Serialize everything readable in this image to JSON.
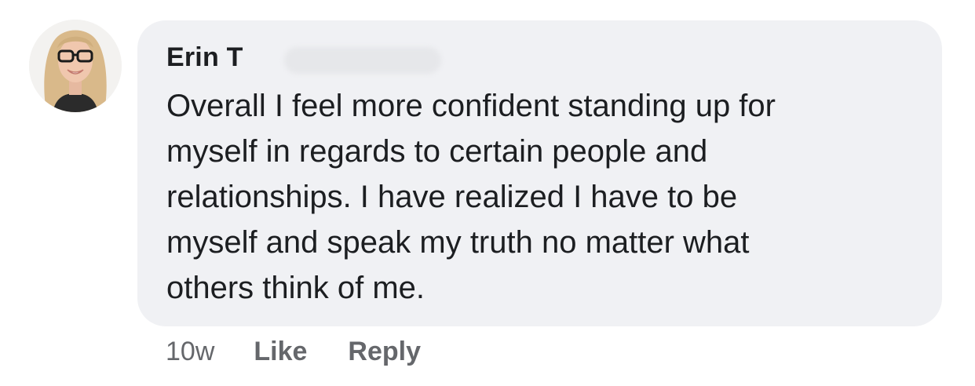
{
  "comment": {
    "author_visible": "Erin T",
    "text": "Overall I feel more confident standing up for\nmyself in regards to certain people and\nrelationships. I have realized I have to be\nmyself and speak my truth no matter what\nothers think of me."
  },
  "actions": {
    "timestamp": "10w",
    "like_label": "Like",
    "reply_label": "Reply"
  },
  "colors": {
    "bubble_background": "#f0f1f4",
    "text_primary": "#1c1e21",
    "text_secondary": "#65676b"
  }
}
